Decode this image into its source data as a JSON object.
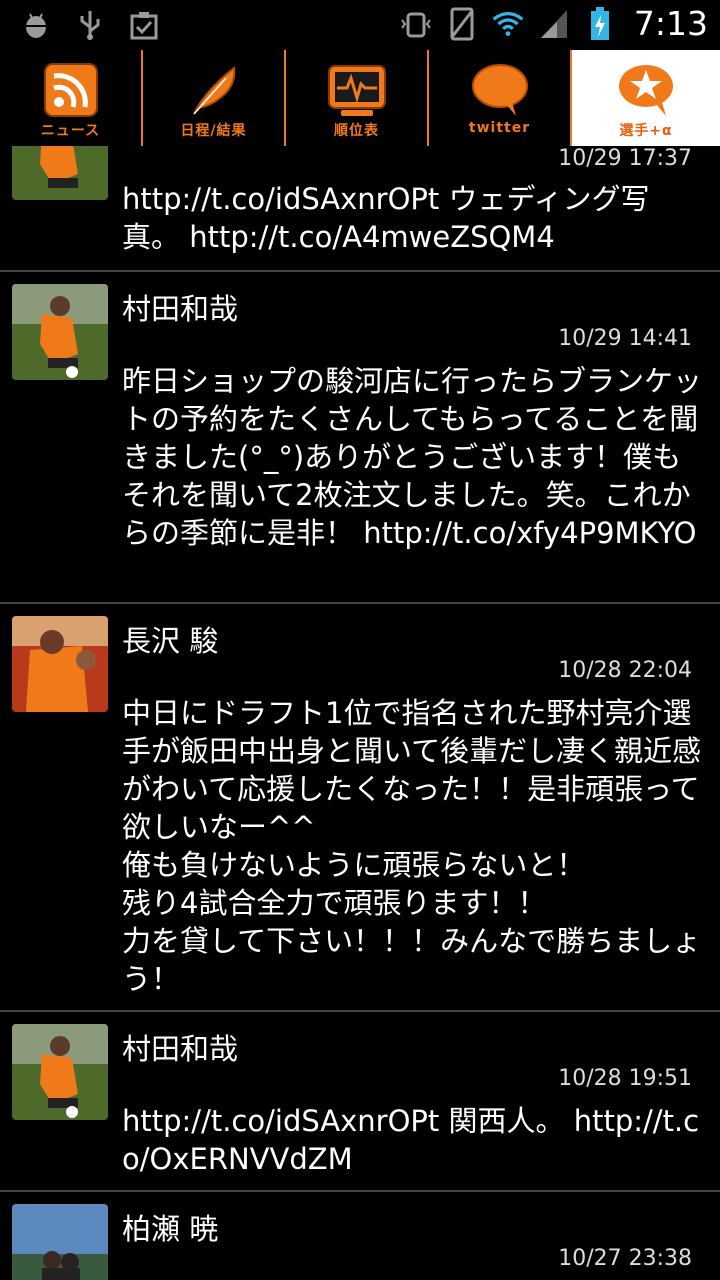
{
  "status_bar": {
    "time": "7:13",
    "left_icons": [
      "android-debug-icon",
      "usb-icon",
      "clipboard-check-icon"
    ],
    "right_icons": [
      "vibrate-lock-icon",
      "no-sim-icon",
      "wifi-icon",
      "signal-icon",
      "battery-charging-icon"
    ]
  },
  "tabs": [
    {
      "label": "ニュース",
      "icon": "rss-icon",
      "active": false
    },
    {
      "label": "日程/結果",
      "icon": "feather-icon",
      "active": false
    },
    {
      "label": "順位表",
      "icon": "pulse-monitor-icon",
      "active": false
    },
    {
      "label": "twitter",
      "icon": "speech-bubble-icon",
      "active": false
    },
    {
      "label": "選手+α",
      "icon": "star-bubble-icon",
      "active": true
    }
  ],
  "feed": [
    {
      "name": "",
      "time": "10/29 17:37",
      "text": "http://t.co/idSAxnrOPt ウェディング写真。 http://t.co/A4mweZSQM4"
    },
    {
      "name": "村田和哉",
      "time": "10/29 14:41",
      "text": "昨日ショップの駿河店に行ったらブランケットの予約をたくさんしてもらってることを聞きました(°_°)ありがとうございます！僕もそれを聞いて2枚注文しました。笑。これからの季節に是非！ http://t.co/xfy4P9MKYO"
    },
    {
      "name": "長沢 駿",
      "time": "10/28 22:04",
      "text": "中日にドラフト1位で指名された野村亮介選手が飯田中出身と聞いて後輩だし凄く親近感がわいて応援したくなった！！是非頑張って欲しいなー^^\n俺も負けないように頑張らないと！\n残り4試合全力で頑張ります！！\n力を貸して下さい！！！みんなで勝ちましょう！"
    },
    {
      "name": "村田和哉",
      "time": "10/28 19:51",
      "text": "http://t.co/idSAxnrOPt 関西人。 http://t.co/OxERNVVdZM"
    },
    {
      "name": "柏瀬 暁",
      "time": "10/27 23:38",
      "text": ""
    }
  ],
  "colors": {
    "accent": "#f07a1a",
    "background": "#000000",
    "divider": "#444444"
  }
}
